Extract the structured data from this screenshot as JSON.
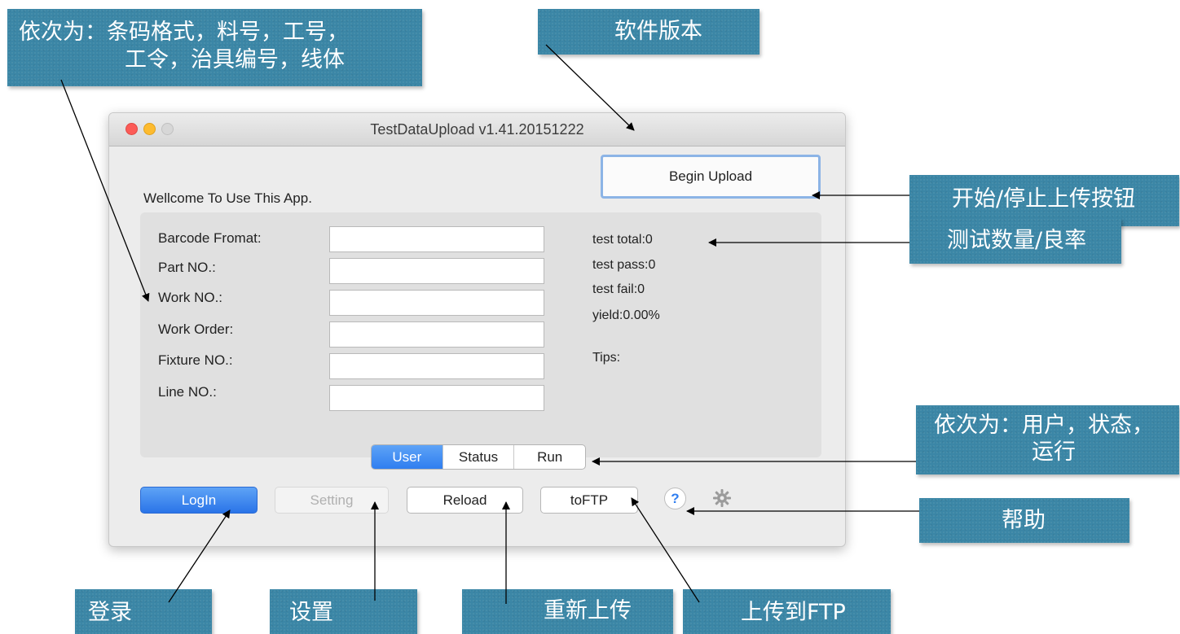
{
  "window": {
    "title": "TestDataUpload v1.41.20151222",
    "welcome": "Wellcome To Use This App.",
    "begin_upload": "Begin Upload"
  },
  "fields": [
    {
      "label": "Barcode Fromat:",
      "value": ""
    },
    {
      "label": "Part NO.:",
      "value": ""
    },
    {
      "label": "Work NO.:",
      "value": ""
    },
    {
      "label": "Work Order:",
      "value": ""
    },
    {
      "label": "Fixture NO.:",
      "value": ""
    },
    {
      "label": "Line NO.:",
      "value": ""
    }
  ],
  "stats": {
    "total": "test total:0",
    "pass": "test pass:0",
    "fail": "test fail:0",
    "yield": "yield:0.00%",
    "tips": "Tips:"
  },
  "segments": [
    {
      "label": "User",
      "active": true
    },
    {
      "label": "Status",
      "active": false
    },
    {
      "label": "Run",
      "active": false
    }
  ],
  "buttons": {
    "login": "LogIn",
    "setting": "Setting",
    "reload": "Reload",
    "toftp": "toFTP"
  },
  "help_glyph": "?",
  "callouts": {
    "fields_line1": "依次为：条码格式，料号，工号，",
    "fields_line2": "工令，治具编号，线体",
    "version": "软件版本",
    "start_stop": "开始/停止上传按钮",
    "counts": "测试数量/良率",
    "segments_line1": "依次为：用户，状态，",
    "segments_line2": "运行",
    "help": "帮助",
    "login": "登录",
    "setting": "设置",
    "reload": "重新上传",
    "toftp": "上传到FTP"
  },
  "colors": {
    "callout_bg": "#3b86a6",
    "accent_blue": "#2f7ef0"
  },
  "icons": [
    "close-light",
    "minimize-light",
    "zoom-light",
    "help-icon",
    "gear-icon"
  ]
}
